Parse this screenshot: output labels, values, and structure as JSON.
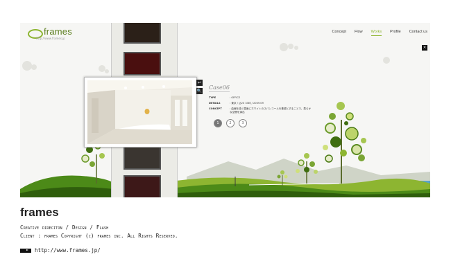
{
  "site": {
    "logo_text": "frames",
    "logo_url": "http://www.frames.jp"
  },
  "nav": {
    "items": [
      {
        "label": "Concept",
        "active": false
      },
      {
        "label": "Flow",
        "active": false
      },
      {
        "label": "Works",
        "active": true
      },
      {
        "label": "Profile",
        "active": false
      },
      {
        "label": "Contact us",
        "active": false
      }
    ]
  },
  "viewer": {
    "close_label": "×",
    "back_label": "↩",
    "zoom_label": "🔍",
    "case_title": "Case06",
    "info": [
      {
        "key": "TYPE",
        "value": ": OFFICE"
      },
      {
        "key": "DETAILS",
        "value": ": 東京 / 込20 33坪 / 2009.09"
      },
      {
        "key": "CONCEPT",
        "value": ": 曲線を描く壁面にホワイトのスパンコールを基調とすることで、柔らかな空間を演出"
      }
    ],
    "pages": [
      "1",
      "2",
      "3"
    ],
    "active_page": 0
  },
  "footer": {
    "title": "frames",
    "credit_line1": "Creative direciton / Design / Flash",
    "credit_line2": "Client : frames  Copyright (c) frames inc. All Rights Reserved.",
    "link_text": "http://www.frames.jp/"
  },
  "colors": {
    "accent_green": "#8db531",
    "dark_green": "#3f6e10",
    "hill_green": "#4c8a18"
  }
}
